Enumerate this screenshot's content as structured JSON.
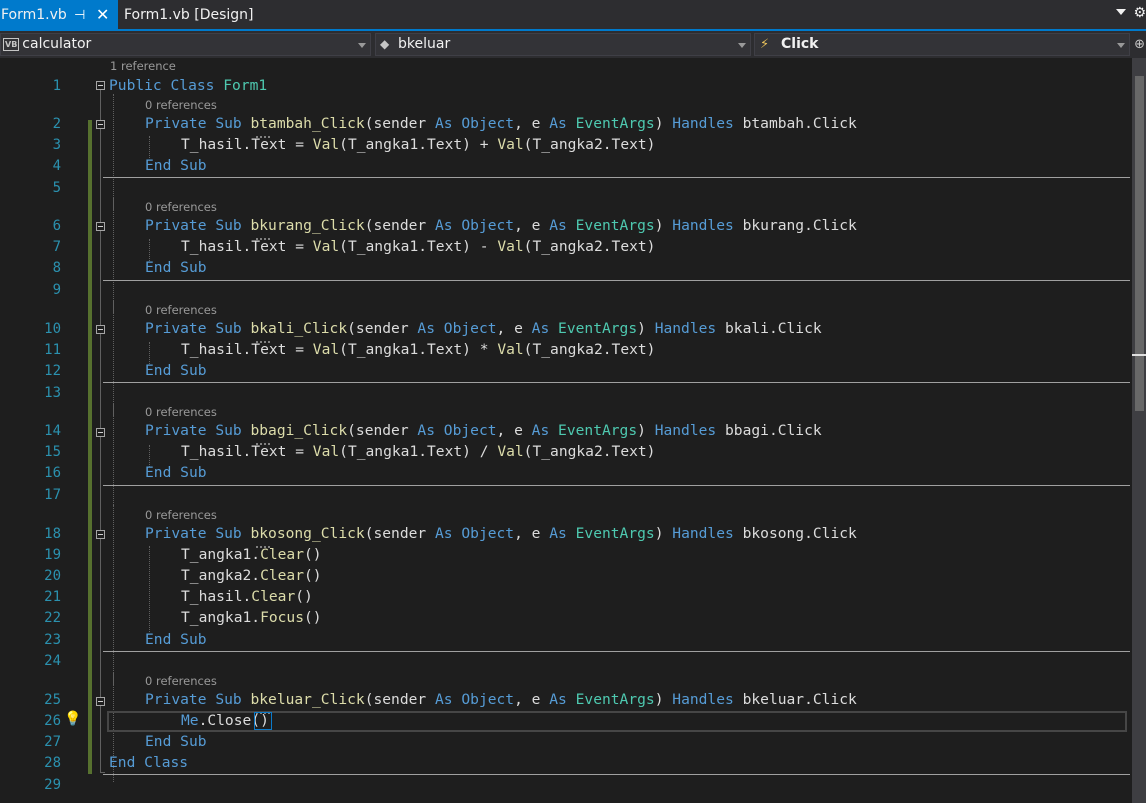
{
  "tabs": [
    {
      "label": "Form1.vb",
      "active": true
    },
    {
      "label": "Form1.vb [Design]",
      "active": false
    }
  ],
  "nav": {
    "project": "calculator",
    "project_icon": "VB",
    "member": "bkeluar",
    "event": "Click"
  },
  "codelens": {
    "class_refs": "1 reference",
    "method_refs": "0 references"
  },
  "line_numbers": [
    "1",
    "2",
    "3",
    "4",
    "5",
    "6",
    "7",
    "8",
    "9",
    "10",
    "11",
    "12",
    "13",
    "14",
    "15",
    "16",
    "17",
    "18",
    "19",
    "20",
    "21",
    "22",
    "23",
    "24",
    "25",
    "26",
    "27",
    "28",
    "29"
  ],
  "code": {
    "l1_public": "Public",
    "l1_class": "Class",
    "l1_name": "Form1",
    "private": "Private",
    "sub": "Sub",
    "as": "As",
    "object": "Object",
    "eventargs": "EventArgs",
    "handles": "Handles",
    "end": "End",
    "val": "Val",
    "m1_name": "btambah_Click",
    "m1_handle": "btambah.Click",
    "m1_body_a": "T_hasil.Text = ",
    "m1_body_b": "(T_angka1.Text) + ",
    "m1_body_c": "(T_angka2.Text)",
    "m2_name": "bkurang_Click",
    "m2_handle": "bkurang.Click",
    "m2_body_b": "(T_angka1.Text) - ",
    "m3_name": "bkali_Click",
    "m3_handle": "bkali.Click",
    "m3_body_b": "(T_angka1.Text) * ",
    "m4_name": "bbagi_Click",
    "m4_handle": "bbagi.Click",
    "m4_body_b": "(T_angka1.Text) / ",
    "m5_name": "bkosong_Click",
    "m5_handle": "bkosong.Click",
    "m5_l1_obj": "T_angka1.",
    "m5_l1_fn": "Clear",
    "m5_l2_obj": "T_angka2.",
    "m5_l3_obj": "T_hasil.",
    "m5_l4_fn": "Focus",
    "parens": "()",
    "m6_name": "bkeluar_Click",
    "m6_handle": "bkeluar.Click",
    "m6_me": "Me",
    "m6_close": ".Close",
    "params_a": "(sender ",
    "params_b": ", e ",
    "params_c": ") "
  }
}
